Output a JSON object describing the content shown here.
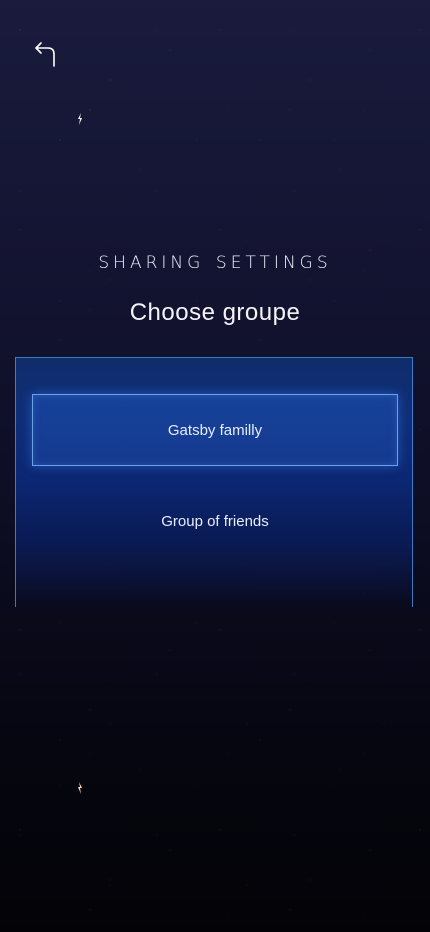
{
  "header": {
    "back_icon": "back-arrow-icon"
  },
  "title": "Sharing settings",
  "subtitle": "Choose groupe",
  "groups": [
    {
      "label": "Gatsby familly",
      "selected": true
    },
    {
      "label": "Group of friends",
      "selected": false
    }
  ],
  "colors": {
    "background_top": "#1a1b3d",
    "background_bottom": "#030307",
    "panel": "#0f2e7a",
    "selected_border": "#6aa0e8",
    "text": "#ffffff"
  }
}
